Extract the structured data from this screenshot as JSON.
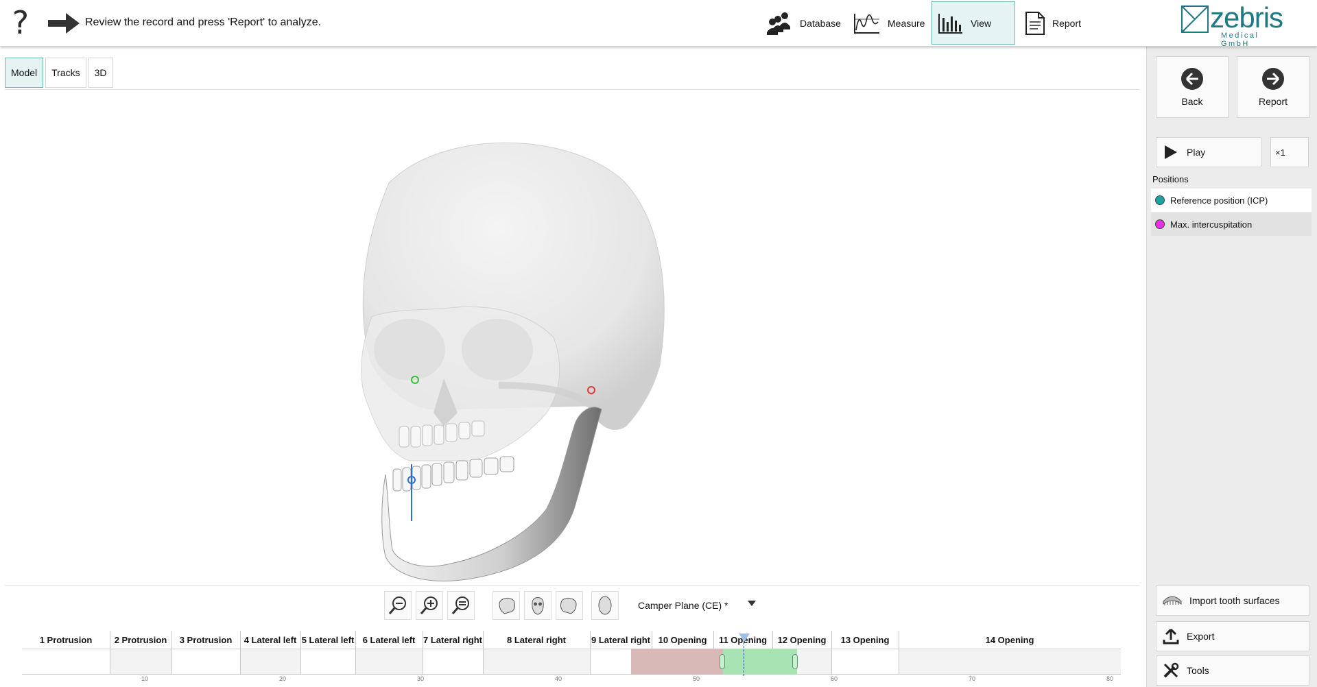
{
  "header": {
    "help_symbol": "?",
    "instruction": "Review the record and press 'Report' to analyze.",
    "nav": [
      {
        "label": "Database",
        "icon": "people-icon",
        "active": false
      },
      {
        "label": "Measure",
        "icon": "chart-measure-icon",
        "active": false
      },
      {
        "label": "View",
        "icon": "bar-chart-icon",
        "active": true
      },
      {
        "label": "Report",
        "icon": "document-icon",
        "active": false
      }
    ],
    "logo": {
      "word": "zebris",
      "sub": "Medical GmbH",
      "color": "#1b7a83"
    }
  },
  "tabs": [
    {
      "label": "Model",
      "active": true
    },
    {
      "label": "Tracks",
      "active": false
    },
    {
      "label": "3D",
      "active": false
    }
  ],
  "view_tools": {
    "plane_value": "Camper Plane (CE) *"
  },
  "timeline": {
    "segments": [
      "1 Protrusion",
      "2 Protrusion",
      "3 Protrusion",
      "4 Lateral left",
      "5 Lateral left",
      "6 Lateral left",
      "7 Lateral right",
      "8 Lateral right",
      "9 Lateral right",
      "10 Opening",
      "11 Opening",
      "12 Opening",
      "13 Opening",
      "14 Opening"
    ],
    "ticks": [
      "10",
      "20",
      "30",
      "40",
      "50",
      "60",
      "70",
      "80"
    ]
  },
  "sidebar": {
    "back_label": "Back",
    "report_label": "Report",
    "play_label": "Play",
    "speed_label": "×1",
    "positions_title": "Positions",
    "positions": [
      {
        "label": "Reference position (ICP)",
        "color": "#1aa3a3"
      },
      {
        "label": "Max. intercuspitation",
        "color": "#e632e0"
      }
    ],
    "import_label": "Import tooth surfaces",
    "export_label": "Export",
    "tools_label": "Tools"
  }
}
